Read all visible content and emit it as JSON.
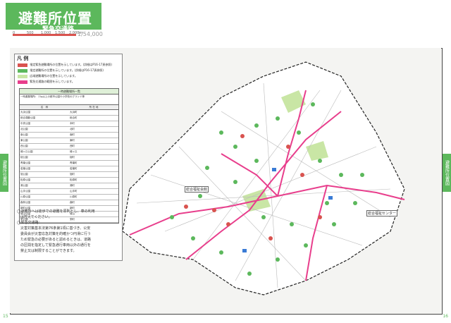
{
  "header": {
    "title": "避難所位置図",
    "subtitle": "緊急交通路",
    "scale_text": "1/54,000",
    "scale_ticks": [
      "0",
      "500",
      "1,000",
      "1,500",
      "2,000m"
    ]
  },
  "side_tabs": {
    "left": "避難所位置図",
    "right": "避難所位置図"
  },
  "page_numbers": {
    "left": "15",
    "right": "16"
  },
  "legend": {
    "title": "凡 例",
    "items": [
      {
        "label": "指定緊急避難場所の位置を示しています。(詳細はP16-17頁参照)",
        "color": "#d9534f"
      },
      {
        "label": "指定避難所の位置を示しています。(詳細はP16-17頁参照)",
        "color": "#5cb85c"
      },
      {
        "label": "広域避難場所の位置を示しています。",
        "color": "#c9e6a5"
      },
      {
        "label": "緊急交通路の範囲を示しています。",
        "color": "#e83e8c"
      }
    ],
    "table": {
      "title": "一時避難場所一覧",
      "note": "一時避難場所：１㏊以上の都市公園や小学校のグランド等",
      "headers": [
        "名　称",
        "所 在 地"
      ],
      "rows": [
        [
          "大浜公園",
          "大浜町"
        ],
        [
          "総合運動公園",
          "総合町"
        ],
        [
          "中央公園",
          "本町"
        ],
        [
          "北公園",
          "北町"
        ],
        [
          "南公園",
          "南町"
        ],
        [
          "東公園",
          "東町"
        ],
        [
          "西公園",
          "西町"
        ],
        [
          "緑ヶ丘公園",
          "緑ヶ丘"
        ],
        [
          "桜公園",
          "桜町"
        ],
        [
          "青葉公園",
          "青葉町"
        ],
        [
          "若葉公園",
          "若葉町"
        ],
        [
          "旭公園",
          "旭町"
        ],
        [
          "松原公園",
          "松原町"
        ],
        [
          "港公園",
          "港町"
        ],
        [
          "山手公園",
          "山手町"
        ],
        [
          "川原公園",
          "川原町"
        ],
        [
          "森林公園",
          "森町"
        ],
        [
          "新町公園",
          "新町"
        ],
        [
          "城山公園",
          "城山"
        ],
        [
          "栄公園",
          "栄町"
        ]
      ]
    }
  },
  "notes": [
    "◯避難所へは徒歩での避難を原則とし、車の利用",
    "　は控えてください。",
    "◯緊急交通路：",
    "　災害対策基本法第76条第1項に基づき、公安",
    "　委員会が災害応急対策を的確かつ円滑に行う",
    "　ため緊急の必要があると認めるときは、道路",
    "　の区間を指定して緊急通行車両以外の通行を",
    "　禁止又は制限することができます。"
  ],
  "map_labels": [
    {
      "text": "総合福祉会館"
    },
    {
      "text": "総合福祉センター"
    }
  ]
}
